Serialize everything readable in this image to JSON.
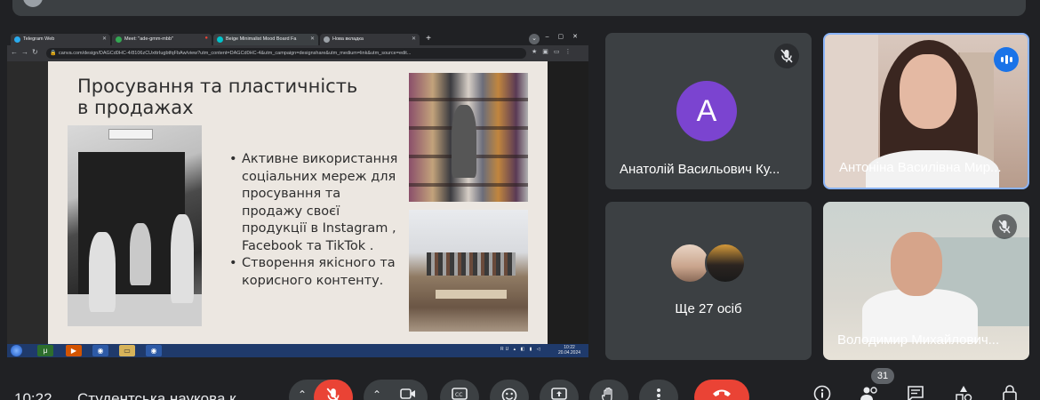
{
  "browser": {
    "tabs": [
      {
        "label": "Telegram Web",
        "color": "#2aabee"
      },
      {
        "label": "Meet: \"ade-gmm-mbb\"",
        "color": "#34a853"
      },
      {
        "label": "Beige Minimalist Mood Board Fa",
        "color": "#00c4cc"
      },
      {
        "label": "Нова вкладка",
        "color": "#9aa0a6"
      }
    ],
    "url": "canva.com/design/DAGCd0HC-4/8106zCUxttrIugbtfqFbAw/view?utm_content=DAGCd0HC-4&utm_campaign=designshare&utm_medium=link&utm_source=edit..."
  },
  "slide": {
    "title": "Просування та пластичність в продажах",
    "bullets": [
      "Активне  використання соціальних мереж для просування та продажу своєї продукції в Instagram , Facebook та TikTok .",
      "Створення якісного та корисного контенту."
    ]
  },
  "taskbar": {
    "tray": "RU",
    "clock_time": "10:22",
    "clock_date": "20.04.2024"
  },
  "participants": [
    {
      "name": "Анатолій Васильович Ку...",
      "initial": "A",
      "avatar_color": "#7b44d0",
      "muted": true
    },
    {
      "name": "Антоніна Василівна Мир...",
      "speaking": true
    },
    {
      "name": "Володимир Михайлович...",
      "muted": true
    }
  ],
  "more": {
    "label": "Ще 27 осіб"
  },
  "bottom": {
    "time": "10:22",
    "meeting_title": "Студентська наукова к",
    "participant_count": "31"
  },
  "colors": {
    "background": "#202124",
    "tile": "#3c4043",
    "accent": "#1a73e8",
    "danger": "#ea4335"
  }
}
